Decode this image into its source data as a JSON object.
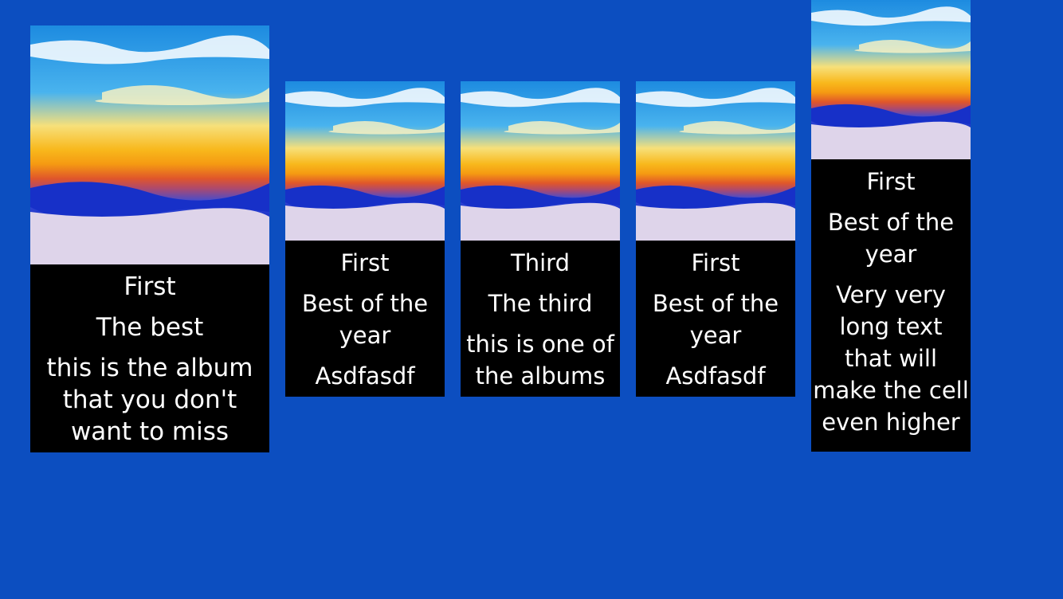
{
  "albums": [
    {
      "artwork": "beach-sunset",
      "title": "First",
      "subtitle": "The best",
      "description": "this is the album that you don't want to miss"
    },
    {
      "artwork": "beach-sunset",
      "title": "First",
      "subtitle": "Best of the year",
      "description": "Asdfasdf"
    },
    {
      "artwork": "beach-sunset",
      "title": "Third",
      "subtitle": "The third",
      "description": "this is one of the albums"
    },
    {
      "artwork": "beach-sunset",
      "title": "First",
      "subtitle": "Best of the year",
      "description": "Asdfasdf"
    },
    {
      "artwork": "beach-sunset",
      "title": "First",
      "subtitle": "Best of the year",
      "description": "Very very long text that will make the cell even higher"
    }
  ],
  "colors": {
    "background": "#0c4ec0",
    "cell": "#000000",
    "text": "#ffffff"
  }
}
